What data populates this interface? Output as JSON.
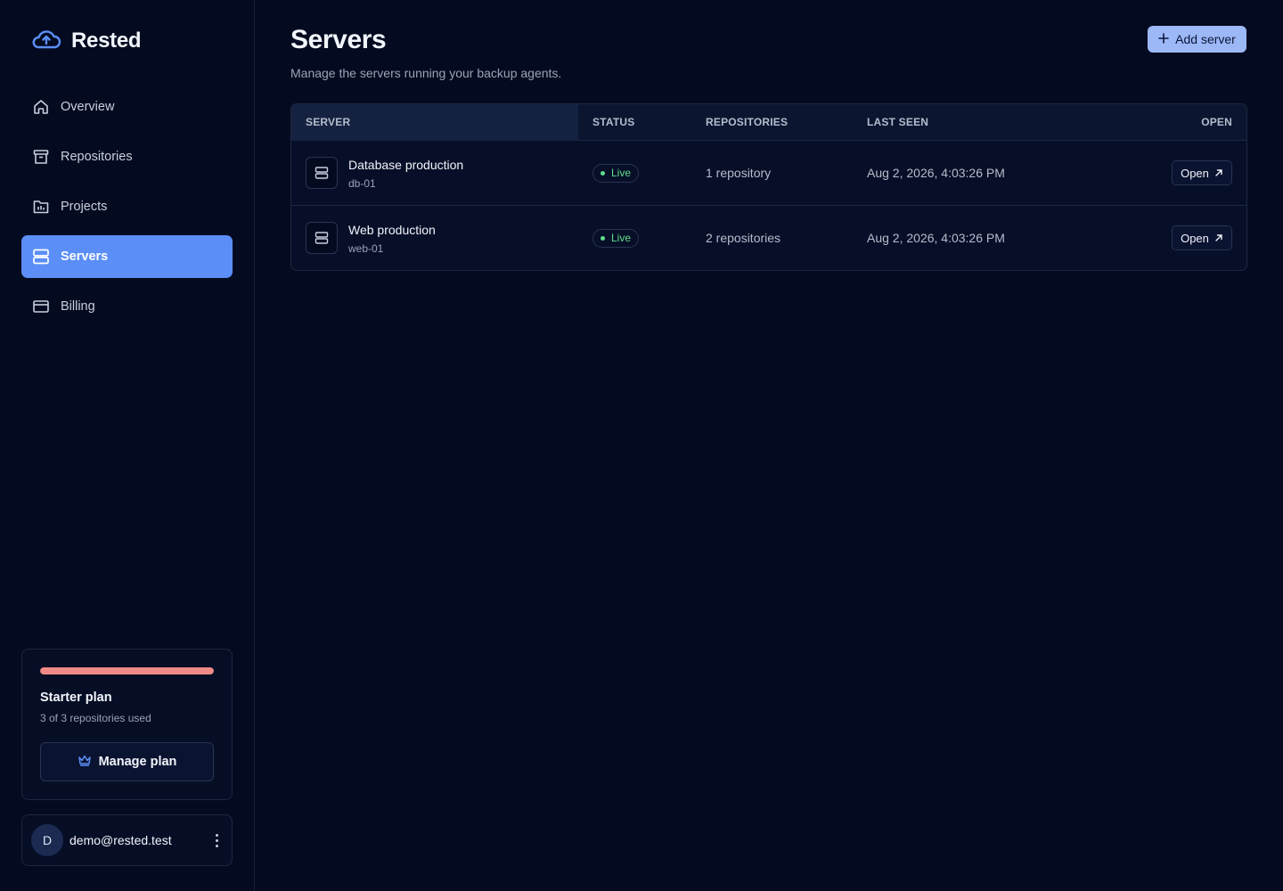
{
  "app": {
    "name": "Rested"
  },
  "sidebar": {
    "items": [
      {
        "label": "Overview",
        "icon": "home-icon",
        "active": false
      },
      {
        "label": "Repositories",
        "icon": "archive-icon",
        "active": false
      },
      {
        "label": "Projects",
        "icon": "folder-chart-icon",
        "active": false
      },
      {
        "label": "Servers",
        "icon": "server-icon",
        "active": true
      },
      {
        "label": "Billing",
        "icon": "credit-card-icon",
        "active": false
      }
    ],
    "plan": {
      "title": "Starter plan",
      "usage": "3 of 3 repositories used",
      "usage_fraction": 1.0,
      "manage_label": "Manage plan"
    },
    "user": {
      "initial": "D",
      "email": "demo@rested.test"
    }
  },
  "page": {
    "title": "Servers",
    "subtitle": "Manage the servers running your backup agents.",
    "add_label": "Add server"
  },
  "table": {
    "columns": [
      "SERVER",
      "STATUS",
      "REPOSITORIES",
      "LAST SEEN",
      "OPEN"
    ],
    "rows": [
      {
        "name": "Database production",
        "host": "db-01",
        "status": "Live",
        "repositories": "1 repository",
        "last_seen": "Aug 2, 2026, 4:03:26 PM",
        "open_label": "Open"
      },
      {
        "name": "Web production",
        "host": "web-01",
        "status": "Live",
        "repositories": "2 repositories",
        "last_seen": "Aug 2, 2026, 4:03:26 PM",
        "open_label": "Open"
      }
    ]
  },
  "colors": {
    "accent": "#5b8ef6",
    "background": "#040b20",
    "live": "#5fdc8a",
    "usage_bar": "#f08a86"
  }
}
